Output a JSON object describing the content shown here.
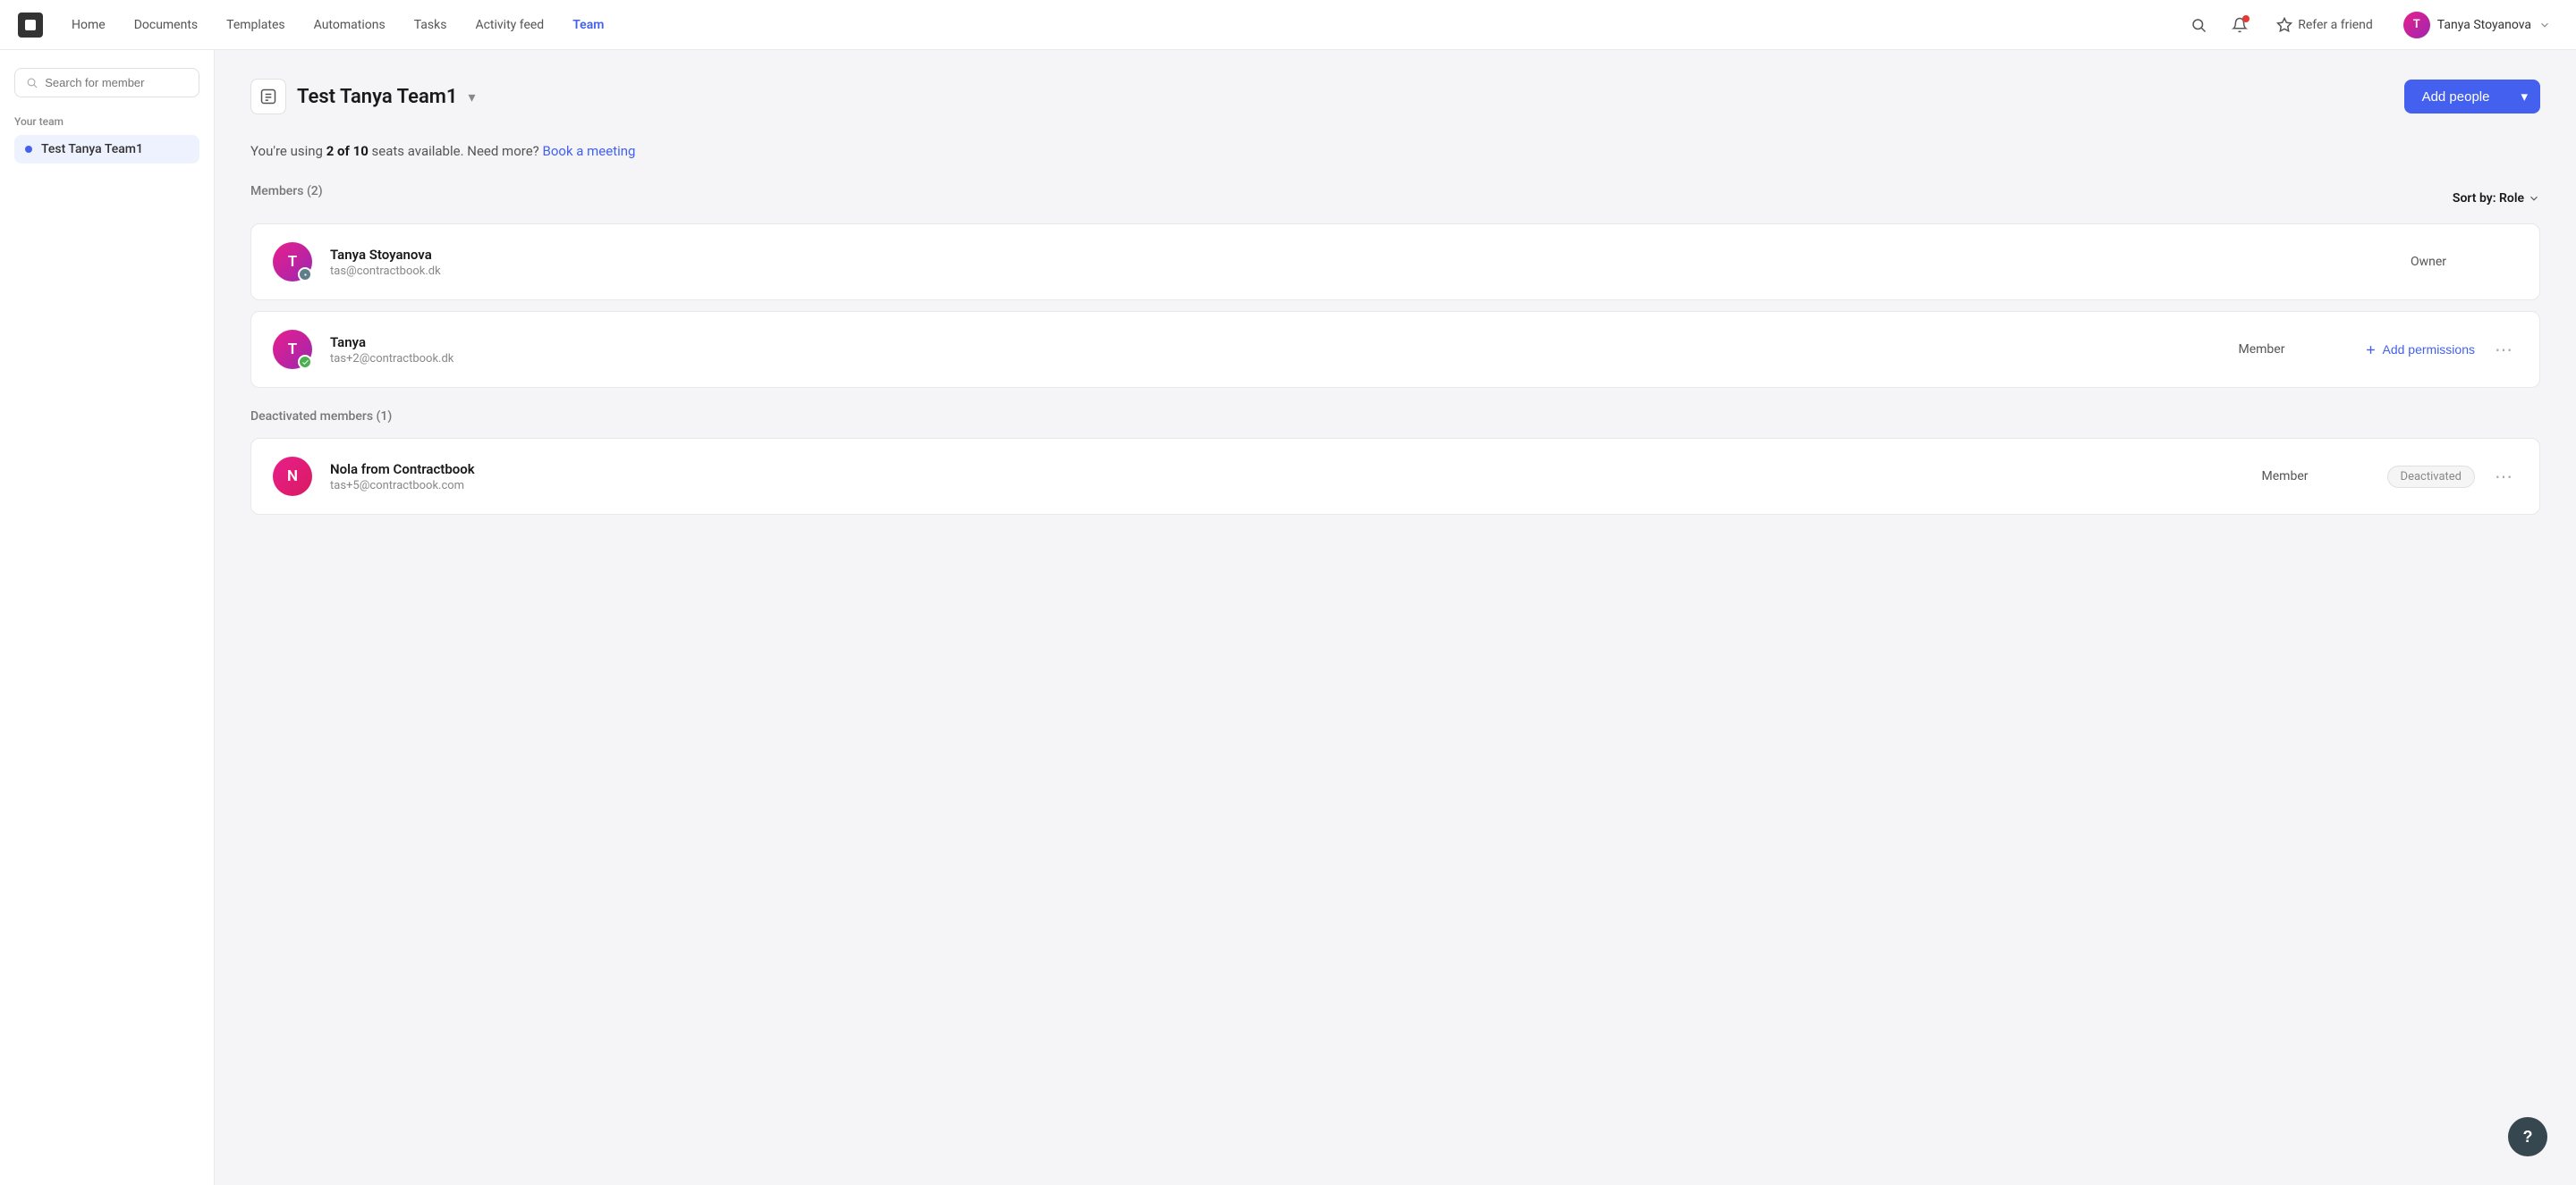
{
  "nav": {
    "items": [
      {
        "id": "home",
        "label": "Home",
        "active": false
      },
      {
        "id": "documents",
        "label": "Documents",
        "active": false
      },
      {
        "id": "templates",
        "label": "Templates",
        "active": false
      },
      {
        "id": "automations",
        "label": "Automations",
        "active": false
      },
      {
        "id": "tasks",
        "label": "Tasks",
        "active": false
      },
      {
        "id": "activity-feed",
        "label": "Activity feed",
        "active": false
      },
      {
        "id": "team",
        "label": "Team",
        "active": true
      }
    ],
    "refer_label": "Refer a friend",
    "user_name": "Tanya Stoyanova",
    "user_initials": "T"
  },
  "sidebar": {
    "search_placeholder": "Search for member",
    "section_label": "Your team",
    "team_item": "Test Tanya Team1"
  },
  "main": {
    "team_title": "Test Tanya Team1",
    "seats_text_prefix": "You're using ",
    "seats_bold": "2 of 10",
    "seats_text_suffix": " seats available. Need more?",
    "seats_link": "Book a meeting",
    "members_section_label": "Members (2)",
    "sort_label_prefix": "Sort by: ",
    "sort_label_value": "Role",
    "add_people_label": "Add people",
    "members": [
      {
        "id": "tanya-stoyanova",
        "name": "Tanya Stoyanova",
        "email": "tas@contractbook.dk",
        "role": "Owner",
        "initials": "T",
        "avatar_color": "#9c27b0",
        "badge_type": "settings"
      },
      {
        "id": "tanya",
        "name": "Tanya",
        "email": "tas+2@contractbook.dk",
        "role": "Member",
        "initials": "T",
        "avatar_color": "#9c27b0",
        "badge_type": "active"
      }
    ],
    "add_permissions_label": "Add permissions",
    "deactivated_section_label": "Deactivated members (1)",
    "deactivated_members": [
      {
        "id": "nola",
        "name": "Nola from Contractbook",
        "email": "tas+5@contractbook.com",
        "role": "Member",
        "initials": "N",
        "avatar_color": "#e91e8c",
        "status": "Deactivated"
      }
    ]
  },
  "help_label": "?"
}
